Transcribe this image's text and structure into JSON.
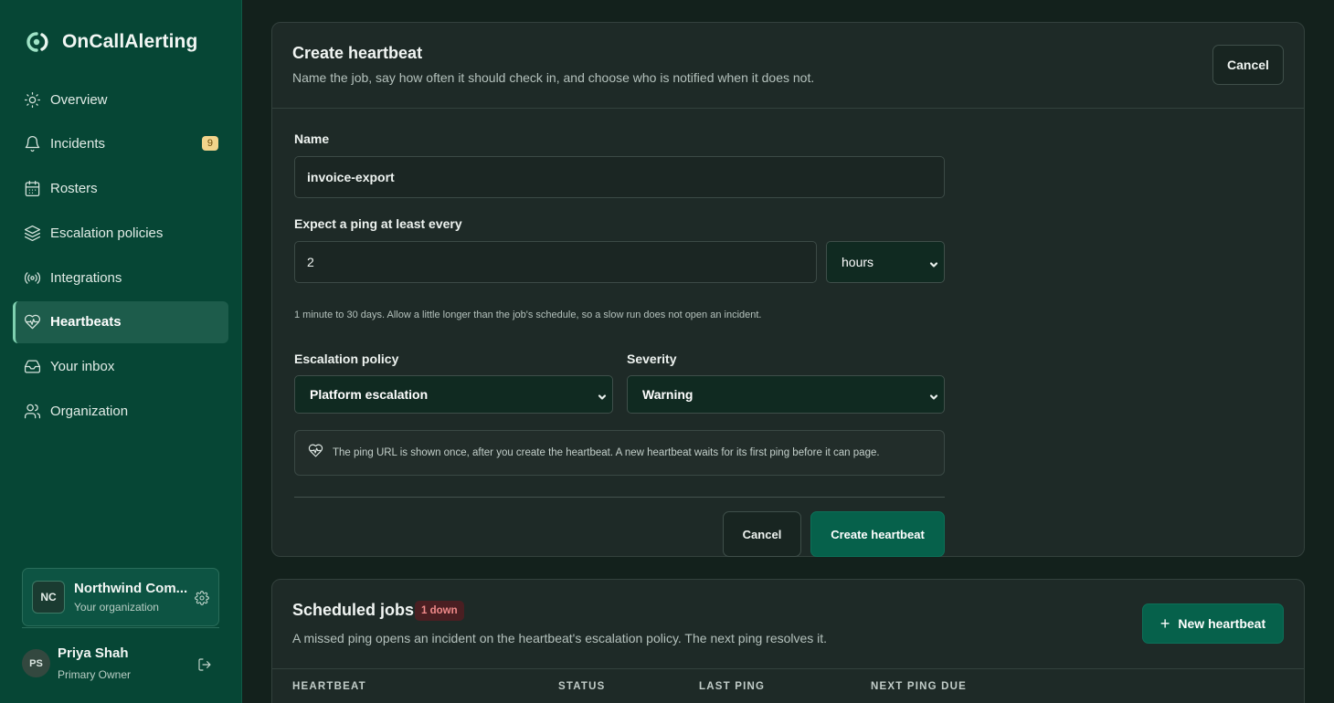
{
  "brand": {
    "name": "OnCallAlerting",
    "icon": "oncall-logo-icon"
  },
  "nav": {
    "items": [
      {
        "label": "Overview",
        "icon": "sun-icon"
      },
      {
        "label": "Incidents",
        "icon": "bell-icon",
        "badge": "9"
      },
      {
        "label": "Rosters",
        "icon": "calendar-icon"
      },
      {
        "label": "Escalation policies",
        "icon": "layers-icon"
      },
      {
        "label": "Integrations",
        "icon": "broadcast-icon"
      },
      {
        "label": "Heartbeats",
        "icon": "heartbeat-icon",
        "active": true
      },
      {
        "label": "Your inbox",
        "icon": "inbox-icon"
      },
      {
        "label": "Organization",
        "icon": "users-icon"
      }
    ]
  },
  "org": {
    "initials": "NC",
    "name": "Northwind Com...",
    "subtitle": "Your organization"
  },
  "user": {
    "initials": "PS",
    "name": "Priya Shah",
    "role": "Primary Owner"
  },
  "create": {
    "title": "Create heartbeat",
    "subtitle": "Name the job, say how often it should check in, and choose who is notified when it does not.",
    "cancel_label": "Cancel",
    "name_label": "Name",
    "name_value": "invoice-export",
    "interval_label": "Expect a ping at least every",
    "interval_value": "2",
    "interval_unit": "hours",
    "interval_hint": "1 minute to 30 days. Allow a little longer than the job's schedule, so a slow run does not open an incident.",
    "policy_label": "Escalation policy",
    "policy_value": "Platform escalation",
    "severity_label": "Severity",
    "severity_value": "Warning",
    "note": "The ping URL is shown once, after you create the heartbeat. A new heartbeat waits for its first ping before it can page.",
    "footer_cancel": "Cancel",
    "submit_label": "Create heartbeat"
  },
  "jobs": {
    "title": "Scheduled jobs",
    "badge": "1 down",
    "subtitle": "A missed ping opens an incident on the heartbeat's escalation policy. The next ping resolves it.",
    "new_label": "New heartbeat",
    "columns": [
      "HEARTBEAT",
      "STATUS",
      "LAST PING",
      "NEXT PING DUE"
    ]
  },
  "colors": {
    "sidebar": "#064635",
    "main_bg": "#13211c",
    "card": "#1e2a27",
    "primary": "#06614b",
    "badge_warn": "#f2d48b",
    "badge_down": "#4a1f22"
  }
}
